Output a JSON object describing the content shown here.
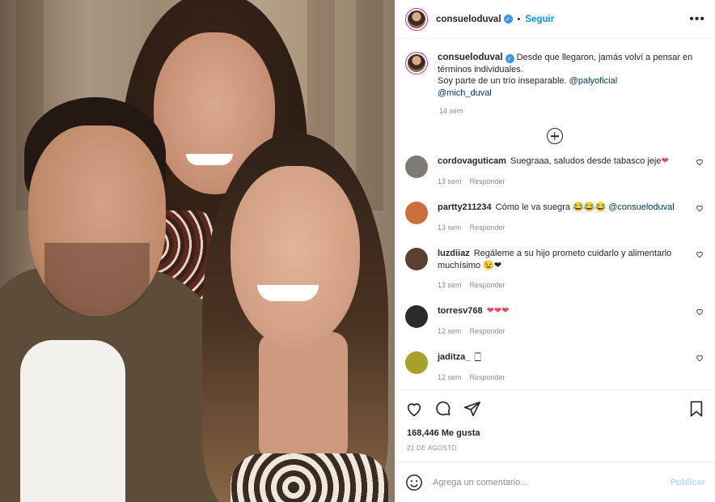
{
  "header": {
    "username": "consueloduval",
    "separator": "•",
    "follow_label": "Seguir",
    "more_label": "•••"
  },
  "caption": {
    "username": "consueloduval",
    "text_line1": "Desde que llegaron, jamás volví a pensar en términos individuales.",
    "text_line2": "Soy parte de un trío inseparable.",
    "mention1": "@palyoficial",
    "mention2": "@mich_duval",
    "time": "14 sem"
  },
  "comments": [
    {
      "username": "cordovaguticam",
      "text": "Suegraaa, saludos desde tabasco jeje",
      "emoji": "❤",
      "time": "13 sem",
      "reply": "Responder",
      "avatar_color": "#7d7a78"
    },
    {
      "username": "partty211234",
      "text": "Cómo le va suegra 😂😂😂",
      "mention": "@consueloduval",
      "time": "13 sem",
      "reply": "Responder",
      "avatar_color": "#c9703a"
    },
    {
      "username": "luzdiiaz",
      "text": "Regáleme a su hijo prometo cuidarlo y alimentarlo muchísimo 😉❤",
      "time": "13 sem",
      "reply": "Responder",
      "avatar_color": "#5a4030"
    },
    {
      "username": "torresv768",
      "text": "",
      "emoji": "❤❤❤",
      "time": "12 sem",
      "reply": "Responder",
      "avatar_color": "#2b2b2b"
    },
    {
      "username": "jaditza_",
      "text": "🀆",
      "time": "12 sem",
      "reply": "Responder",
      "avatar_color": "#a7a02c"
    }
  ],
  "actions": {
    "likes": "168,446 Me gusta",
    "date": "21 DE AGOSTO"
  },
  "add_comment": {
    "placeholder": "Agrega un comentario...",
    "publish_label": "Publicar"
  },
  "icons": {
    "like": "heart-icon",
    "comment": "comment-icon",
    "share": "paper-plane-icon",
    "save": "bookmark-icon",
    "emoji": "smiley-icon",
    "more": "more-options-icon",
    "load_more": "plus-circle-icon"
  },
  "colors": {
    "link": "#0095f6",
    "mention": "#00376b",
    "muted": "#8e8e8e",
    "heart_red": "#ed4956",
    "verified": "#3897f0"
  }
}
